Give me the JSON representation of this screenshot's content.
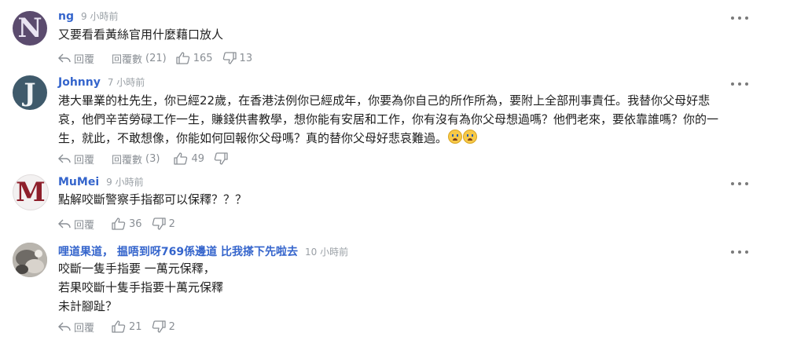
{
  "labels": {
    "reply": "回覆",
    "replies_prefix": "回覆數"
  },
  "comments": [
    {
      "author": "ng",
      "time": "9 小時前",
      "lines": [
        "又要看看黃絲官用什麼藉口放人"
      ],
      "replies": "(21)",
      "likes": "165",
      "dislikes": "13",
      "avatar": {
        "letter": "N",
        "bg": "#5b4b6e",
        "fg": "#e9e4f2"
      }
    },
    {
      "author": "Johnny",
      "time": "7 小時前",
      "lines": [
        "港大畢業的杜先生，你已經22歲，在香港法例你已經成年，你要為你自己的所作所為，要附上全部刑事責任。我替你父母好悲",
        "哀，他們辛苦勞碌工作一生，賺錢供書教學，想你能有安居和工作，你有沒有為你父母想過嗎？他們老來，要依靠誰嗎？你的一",
        "生，就此，不敢想像，你能如何回報你父母嗎？真的替你父母好悲哀難過。"
      ],
      "emoji": [
        "crying-face",
        "crying-face"
      ],
      "replies": "(3)",
      "likes": "49",
      "dislikes": "",
      "avatar": {
        "letter": "J",
        "bg": "#3f5a6b",
        "fg": "#f1f4f6"
      }
    },
    {
      "author": "MuMei",
      "time": "9 小時前",
      "lines": [
        "點解咬斷警察手指都可以保釋？？？"
      ],
      "replies": "",
      "likes": "36",
      "dislikes": "2",
      "avatar": {
        "letter": "M",
        "bg": "#f3f1f1",
        "fg": "#8e1f2b"
      }
    },
    {
      "author": "哩道果道， 揾唔到呀769係邊道 比我搽下先啦去",
      "time": "10 小時前",
      "lines": [
        "咬斷一隻手指要 一萬元保釋，",
        "若果咬斷十隻手指要十萬元保釋",
        "未計腳趾？"
      ],
      "replies": "",
      "likes": "21",
      "dislikes": "2",
      "avatar": {
        "letter": "",
        "bg": "#8d8a86",
        "fg": "#ffffff"
      }
    }
  ],
  "colors": {
    "author": "#3565cc",
    "meta": "#9aa0a6",
    "icon": "#8a8f95"
  },
  "icons": [
    "reply-arrow-icon",
    "thumbs-up-icon",
    "thumbs-down-icon",
    "more-options-icon",
    "crying-face-emoji"
  ]
}
